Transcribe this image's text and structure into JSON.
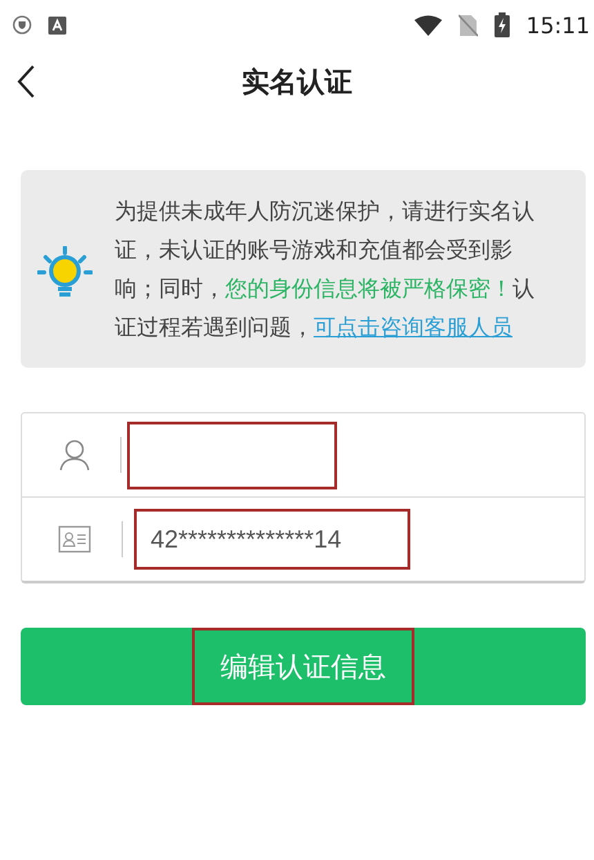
{
  "status_bar": {
    "time": "15:11"
  },
  "header": {
    "title": "实名认证"
  },
  "notice": {
    "segments": [
      {
        "kind": "plain",
        "text": "为提供未成年人防沉迷保护，请进行实名认证，未认证的账号游戏和充值都会受到影响；同时，"
      },
      {
        "kind": "emphasis",
        "text": "您的身份信息将被严格保密！"
      },
      {
        "kind": "plain",
        "text": "认证过程若遇到问题，"
      },
      {
        "kind": "link",
        "text": "可点击咨询客服人员"
      }
    ]
  },
  "fields": [
    {
      "kind": "name",
      "highlighted": true
    },
    {
      "kind": "id",
      "value": "42**************14",
      "highlighted": true
    }
  ],
  "button": {
    "label": "编辑认证信息",
    "highlighted": true
  }
}
